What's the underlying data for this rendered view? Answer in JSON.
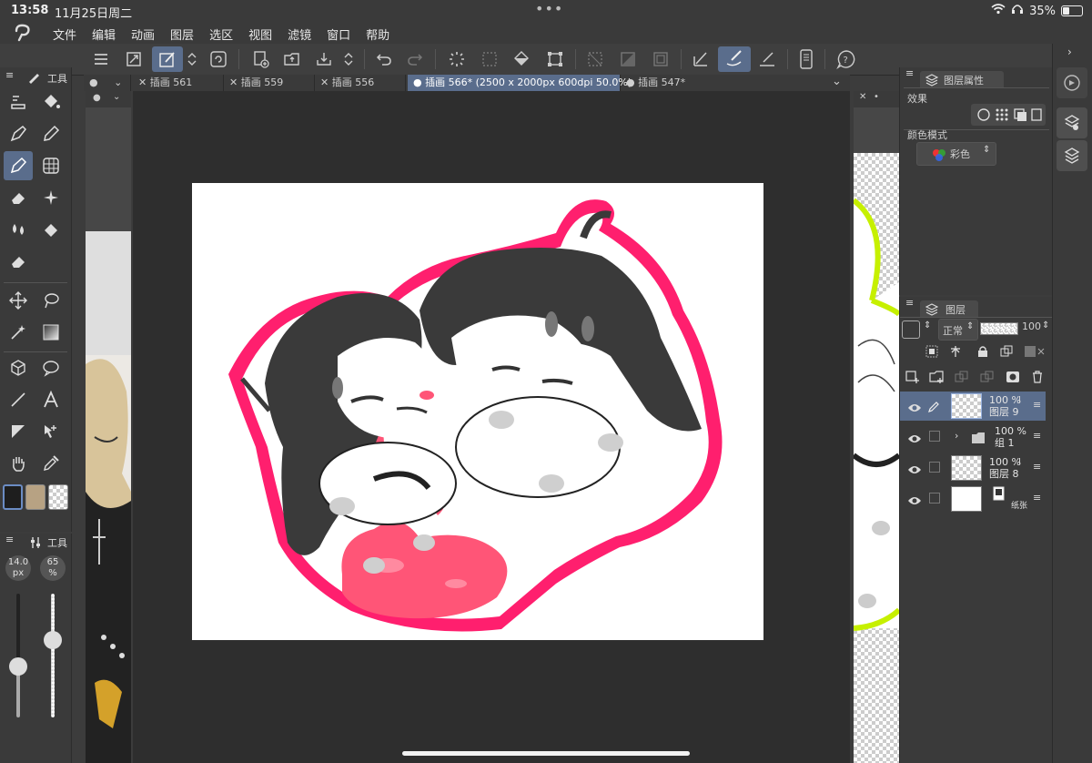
{
  "status": {
    "time": "13:58",
    "date": "11月25日周二",
    "battery": "35%",
    "battery_level": 0.35
  },
  "menu": [
    "文件",
    "编辑",
    "动画",
    "图层",
    "选区",
    "视图",
    "滤镜",
    "窗口",
    "帮助"
  ],
  "tool_panel": {
    "title": "工具"
  },
  "brush_panel": {
    "title": "工具",
    "size_value": "14.0",
    "size_unit": "px",
    "opacity_value": "65",
    "opacity_unit": "%",
    "size_level": 0.4,
    "opacity_level": 0.65
  },
  "tabs": [
    {
      "label": "插画 561",
      "active": false
    },
    {
      "label": "插画 559",
      "active": false
    },
    {
      "label": "插画 556",
      "active": false
    },
    {
      "label": "插画 566* (2500 x 2000px 600dpi 50.0%)",
      "active": true
    },
    {
      "label": "插画 547*",
      "active": false
    }
  ],
  "layer_props": {
    "title": "图层属性",
    "effect_label": "效果",
    "color_mode_label": "颜色模式",
    "color_mode_value": "彩色"
  },
  "layers_panel": {
    "title": "图层",
    "blend_mode": "正常",
    "opacity": "100",
    "layers": [
      {
        "opacity": "100 %",
        "name": "图层 9",
        "selected": true,
        "thumb": "checker"
      },
      {
        "opacity": "100 %",
        "name": "组 1",
        "selected": false,
        "thumb": "folder"
      },
      {
        "opacity": "100 %",
        "name": "图层 8",
        "selected": false,
        "thumb": "checker"
      },
      {
        "opacity": "",
        "name": "纸张",
        "selected": false,
        "thumb": "paper"
      }
    ]
  },
  "colors": {
    "accent": "#5a6d8c",
    "outline": "#ff1f6e",
    "slime": "#ff5577",
    "neon": "#c6f000"
  }
}
